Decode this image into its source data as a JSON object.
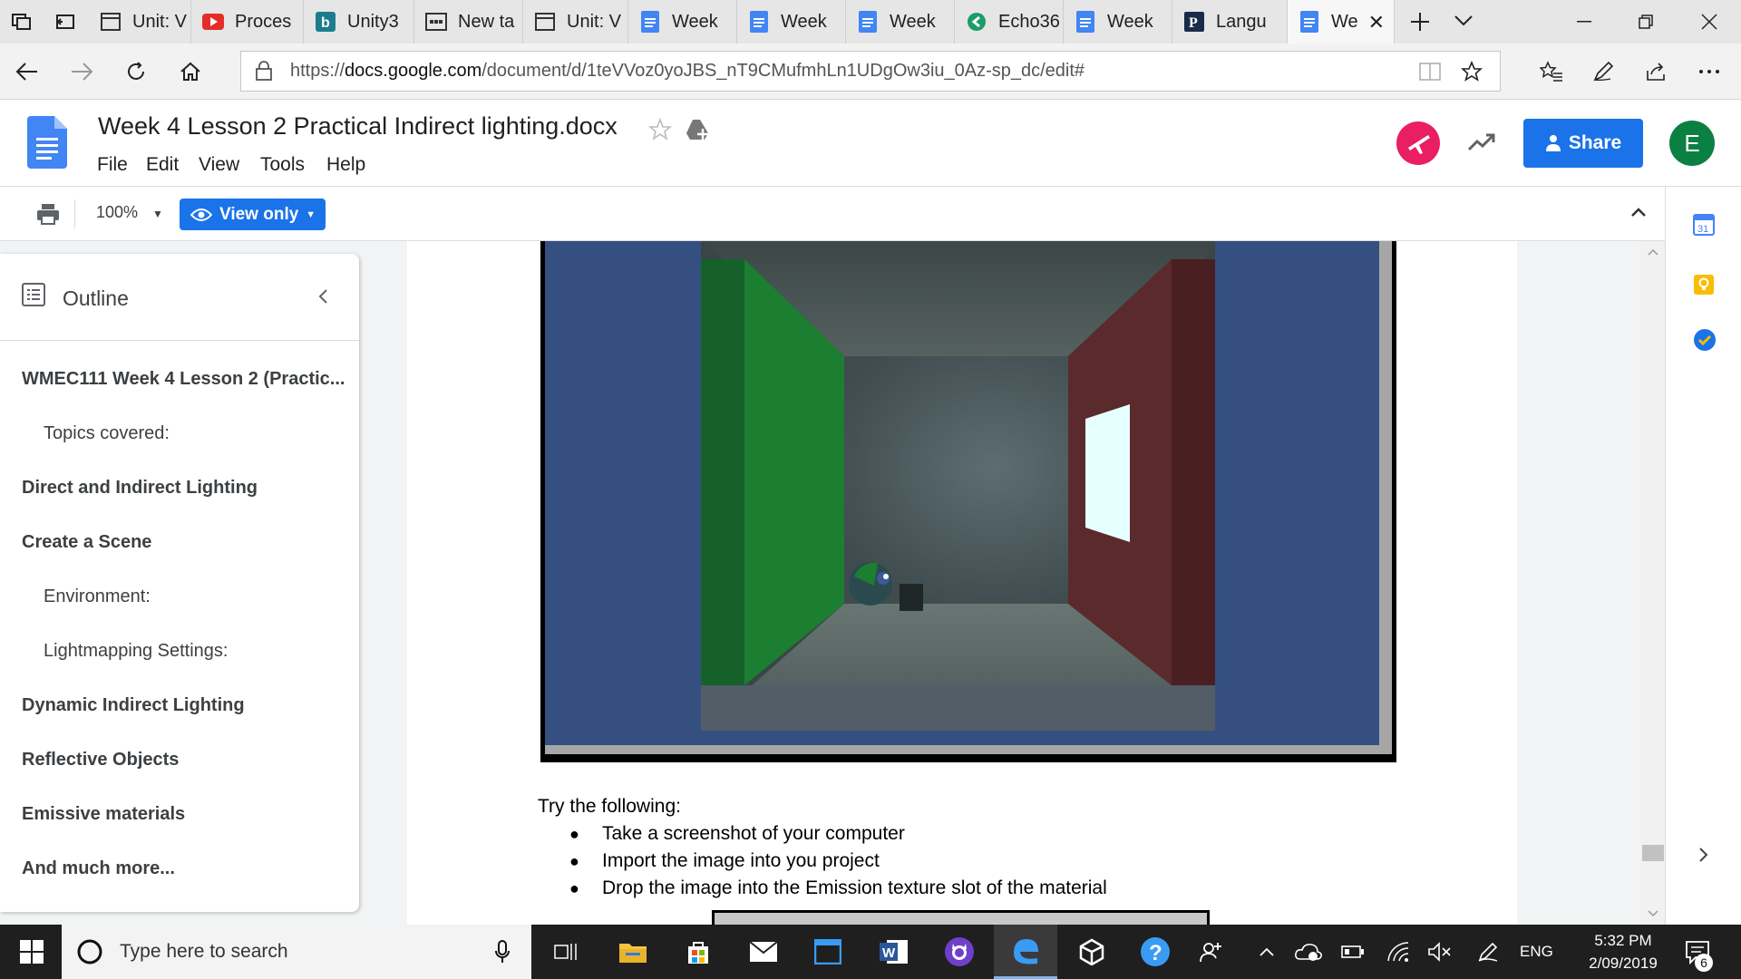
{
  "browser": {
    "tabs": [
      {
        "label": "Unit: V",
        "icon": "page-icon"
      },
      {
        "label": "Proces",
        "icon": "youtube-icon"
      },
      {
        "label": "Unity3",
        "icon": "bing-icon"
      },
      {
        "label": "New ta",
        "icon": "newtab-icon"
      },
      {
        "label": "Unit: V",
        "icon": "page-icon"
      },
      {
        "label": "Week",
        "icon": "docs-icon"
      },
      {
        "label": "Week",
        "icon": "docs-icon"
      },
      {
        "label": "Week",
        "icon": "docs-icon"
      },
      {
        "label": "Echo36",
        "icon": "echo-icon"
      },
      {
        "label": "Week",
        "icon": "docs-icon"
      },
      {
        "label": "Langu",
        "icon": "p-icon"
      },
      {
        "label": "We",
        "icon": "docs-icon",
        "active": true
      }
    ],
    "url_prefix": "https://",
    "url_domain": "docs.google.com",
    "url_path": "/document/d/1teVVoz0yoJBS_nT9CMufmhLn1UDgOw3iu_0Az-sp_dc/edit#"
  },
  "docs": {
    "title": "Week 4 Lesson 2 Practical Indirect lighting.docx",
    "menu": [
      "File",
      "Edit",
      "View",
      "Tools",
      "Help"
    ],
    "share_label": "Share",
    "avatar_letter": "E",
    "zoom": "100%",
    "mode_label": "View only"
  },
  "outline": {
    "title": "Outline",
    "items": [
      {
        "text": "WMEC111 Week 4 Lesson 2 (Practic...",
        "level": 1
      },
      {
        "text": "Topics covered:",
        "level": 2
      },
      {
        "text": "Direct and Indirect Lighting",
        "level": 1
      },
      {
        "text": "Create a Scene",
        "level": 1
      },
      {
        "text": "Environment:",
        "level": 2
      },
      {
        "text": "Lightmapping Settings:",
        "level": 2
      },
      {
        "text": "Dynamic Indirect Lighting",
        "level": 1
      },
      {
        "text": "Reflective Objects",
        "level": 1
      },
      {
        "text": "Emissive materials",
        "level": 1
      },
      {
        "text": "And much more...",
        "level": 1
      }
    ]
  },
  "content": {
    "intro": "Try the following:",
    "bullets": [
      "Take a screenshot of your computer",
      "Import the image into you project",
      "Drop the image into the Emission texture slot of the material"
    ]
  },
  "taskbar": {
    "search_placeholder": "Type here to search",
    "language": "ENG",
    "time": "5:32 PM",
    "date": "2/09/2019",
    "notification_count": "6"
  },
  "colors": {
    "share_blue": "#1a73e8",
    "avatar_green": "#0b8043",
    "accent_pink": "#e91e63"
  }
}
